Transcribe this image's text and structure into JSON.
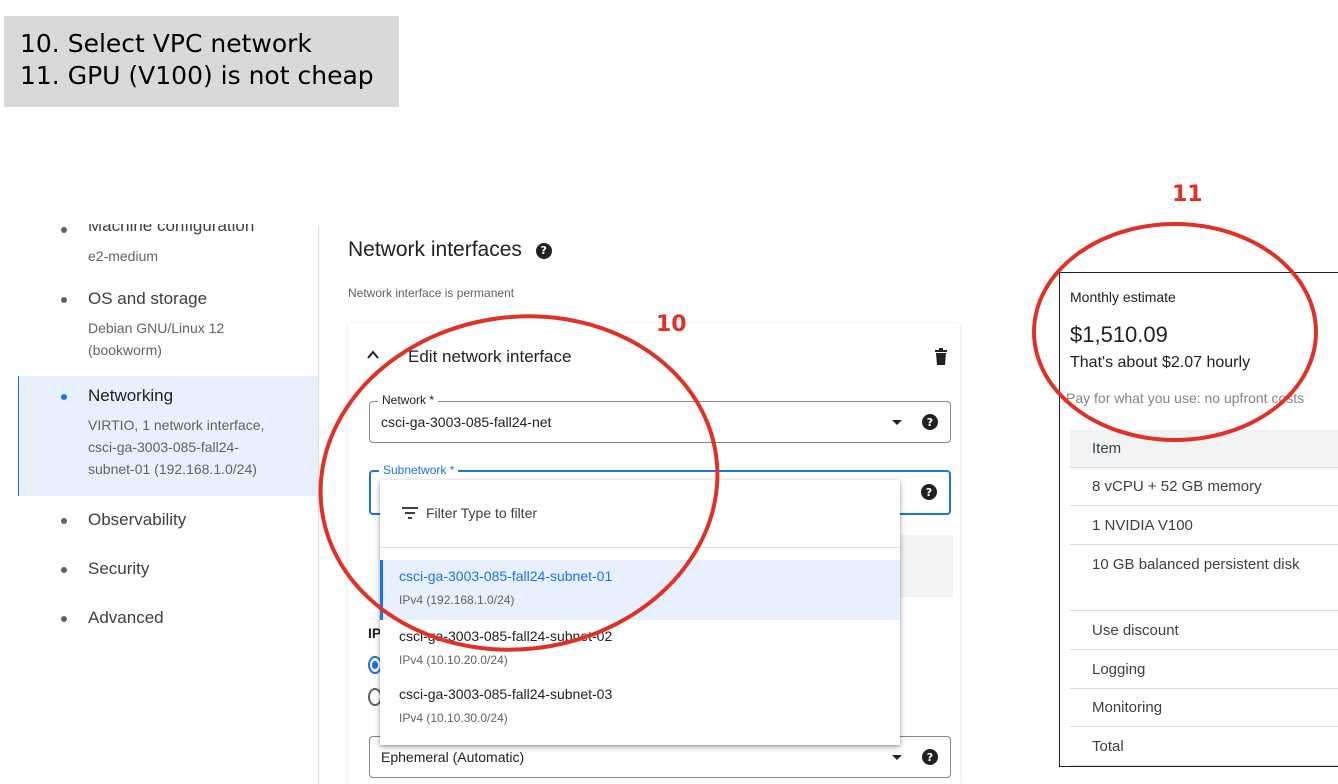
{
  "caption": {
    "line1": "10. Select VPC network",
    "line2": "11. GPU (V100) is not cheap"
  },
  "sidebar": {
    "items": [
      {
        "title": "Machine configuration",
        "sub": [
          "e2-medium"
        ]
      },
      {
        "title": "OS and storage",
        "sub": [
          "Debian GNU/Linux 12",
          "(bookworm)"
        ]
      },
      {
        "title": "Networking",
        "sub": [
          "VIRTIO, 1 network interface,",
          "csci-ga-3003-085-fall24-",
          "subnet-01 (192.168.1.0/24)"
        ],
        "active": true
      },
      {
        "title": "Observability",
        "sub": []
      },
      {
        "title": "Security",
        "sub": []
      },
      {
        "title": "Advanced",
        "sub": []
      }
    ]
  },
  "network": {
    "title": "Network interfaces",
    "subtitle": "Network interface is permanent",
    "card_title": "Edit network interface",
    "network_field": {
      "label": "Network *",
      "value": "csci-ga-3003-085-fall24-net"
    },
    "subnetwork_field": {
      "label": "Subnetwork *",
      "value": ""
    },
    "ip_label": "IP",
    "external_ip_value": "Ephemeral (Automatic)",
    "help_glyph": "?"
  },
  "subnet_menu": {
    "filter_label": "Filter",
    "filter_placeholder": "Type to filter",
    "options": [
      {
        "name": "csci-ga-3003-085-fall24-subnet-01",
        "sub": "IPv4 (192.168.1.0/24)",
        "selected": true
      },
      {
        "name": "csci-ga-3003-085-fall24-subnet-02",
        "sub": "IPv4 (10.10.20.0/24)",
        "selected": false
      },
      {
        "name": "csci-ga-3003-085-fall24-subnet-03",
        "sub": "IPv4 (10.10.30.0/24)",
        "selected": false
      }
    ]
  },
  "annotations": {
    "marker_10": "10",
    "marker_11": "11",
    "color": "#e03127"
  },
  "estimate": {
    "label": "Monthly estimate",
    "amount": "$1,510.09",
    "hourly": "That's about $2.07 hourly",
    "note": "Pay for what you use: no upfront costs",
    "items": [
      "Item",
      "8 vCPU + 52 GB memory",
      "1 NVIDIA V100",
      "10 GB balanced persistent disk",
      "Use discount",
      "Logging",
      "Monitoring",
      "Total"
    ]
  },
  "colors": {
    "accent": "#1a73e8",
    "selected_bg": "#e8f0fe"
  }
}
